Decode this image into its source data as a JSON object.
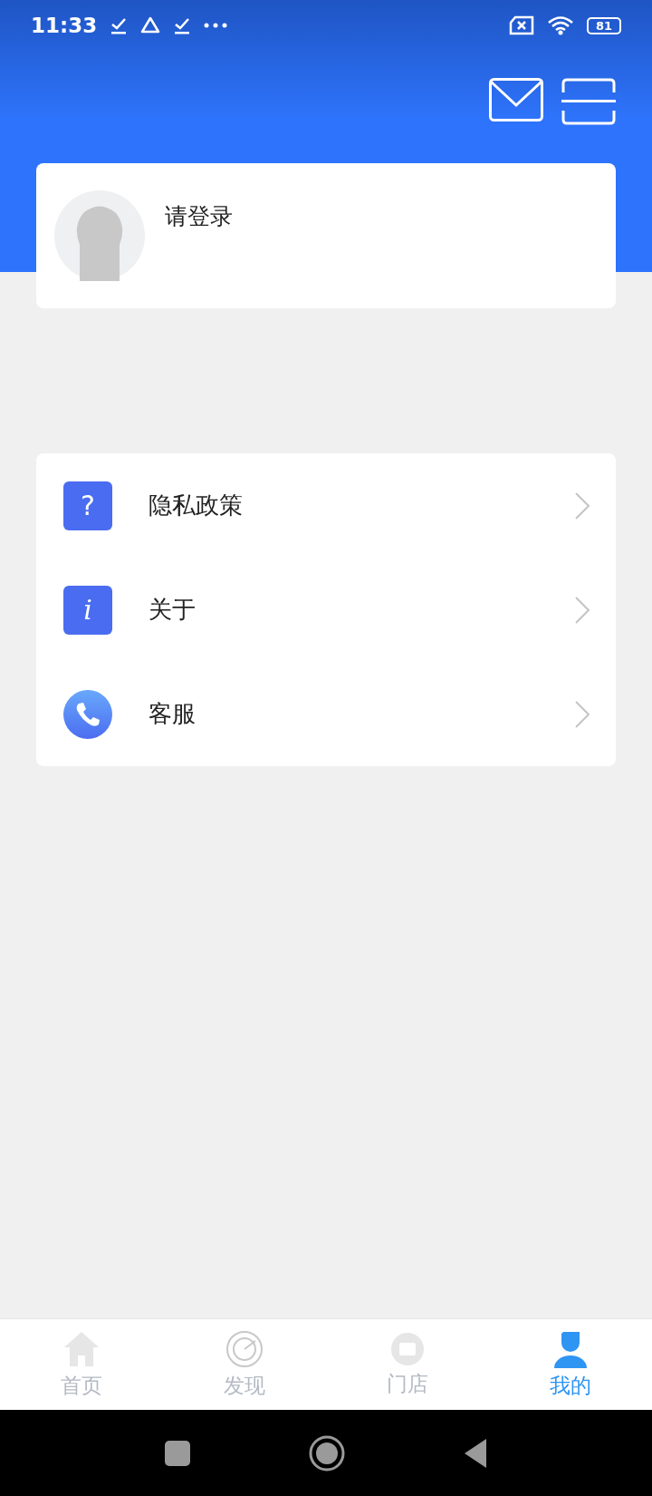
{
  "status_bar": {
    "time": "11:33",
    "battery": "81"
  },
  "profile": {
    "login_prompt": "请登录"
  },
  "menu": [
    {
      "kind": "question",
      "glyph": "?",
      "label": "隐私政策"
    },
    {
      "kind": "info",
      "glyph": "i",
      "label": "关于"
    },
    {
      "kind": "phone",
      "label": "客服"
    }
  ],
  "tab_bar": [
    {
      "kind": "home",
      "label": "首页",
      "selected": false
    },
    {
      "kind": "discover",
      "label": "发现",
      "selected": false
    },
    {
      "kind": "store",
      "label": "门店",
      "selected": false
    },
    {
      "kind": "me",
      "label": "我的",
      "selected": true
    }
  ]
}
